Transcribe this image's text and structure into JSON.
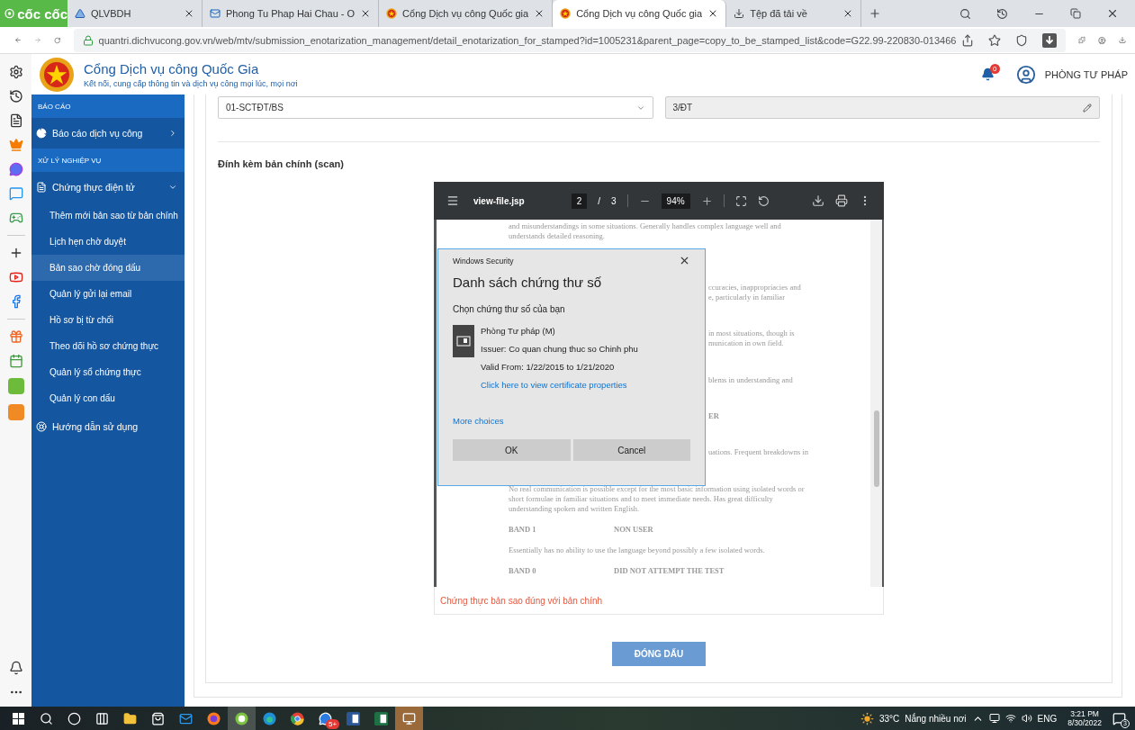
{
  "browser": {
    "logo_text": "cốc cốc",
    "tabs": [
      {
        "label": "QLVBDH",
        "kind": "portal",
        "selected": false
      },
      {
        "label": "Phong Tu Phap Hai Chau - O",
        "kind": "mail",
        "selected": false
      },
      {
        "label": "Cổng Dịch vụ công Quốc gia",
        "kind": "emblem",
        "selected": false
      },
      {
        "label": "Cổng Dịch vụ công Quốc gia",
        "kind": "emblem",
        "selected": true
      },
      {
        "label": "Tệp đã tải về",
        "kind": "download",
        "selected": false
      }
    ],
    "url": "quantri.dichvucong.gov.vn/web/mtv/submission_enotarization_management/detail_enotarization_for_stamped?id=1005231&parent_page=copy_to_be_stamped_list&code=G22.99-220830-013466"
  },
  "header": {
    "title": "Cổng Dịch vụ công Quốc Gia",
    "subtitle": "Kết nối, cung cấp thông tin và dịch vụ công mọi lúc, mọi nơi",
    "notifications": "0",
    "user": "PHÒNG TƯ PHÁP"
  },
  "sidebar": {
    "items": [
      {
        "kind": "section",
        "label": "BÁO CÁO"
      },
      {
        "kind": "menu",
        "label": "Báo cáo dịch vụ công",
        "expanded": false
      },
      {
        "kind": "section",
        "label": "XỬ LÝ NGHIỆP VỤ"
      },
      {
        "kind": "menu",
        "label": "Chứng thực điện tử",
        "expanded": true,
        "children": [
          {
            "label": "Thêm mới bản sao từ bản chính",
            "selected": false
          },
          {
            "label": "Lịch hẹn chờ duyệt",
            "selected": false
          },
          {
            "label": "Bản sao chờ đóng dấu",
            "selected": true
          },
          {
            "label": "Quản lý gửi lại email",
            "selected": false
          },
          {
            "label": "Hồ sơ bị từ chối",
            "selected": false
          },
          {
            "label": "Theo dõi hồ sơ chứng thực",
            "selected": false
          },
          {
            "label": "Quản lý sổ chứng thực",
            "selected": false
          },
          {
            "label": "Quản lý con dấu",
            "selected": false
          }
        ]
      },
      {
        "kind": "menu",
        "label": "Hướng dẫn sử dụng"
      }
    ]
  },
  "form": {
    "fields": [
      {
        "kind": "select",
        "value": "01-SCTĐT/BS"
      },
      {
        "kind": "readonly",
        "value": "3/ĐT"
      }
    ],
    "attachment_label": "Đính kèm bản chính (scan)"
  },
  "viewer": {
    "file": "view-file.jsp",
    "page": "2",
    "page_separator": "/",
    "page_count": "3",
    "zoom": "94%",
    "blocks": [
      {
        "kind": "paragraph",
        "lines": [
          "and misunderstandings in some situations. Generally handles complex language well and",
          "understands detailed reasoning."
        ]
      },
      {
        "kind": "clipped",
        "lines": [
          "ccuracies, inappropriacies and",
          "e, particularly in familiar"
        ]
      },
      {
        "kind": "clipped",
        "lines": [
          "in most situations, though is",
          "munication in own field."
        ]
      },
      {
        "kind": "clipped",
        "lines": [
          "blems in understanding and"
        ]
      },
      {
        "kind": "clipped_heading",
        "lines": [
          "ER"
        ]
      },
      {
        "kind": "clipped",
        "lines": [
          "uations. Frequent breakdowns in"
        ]
      },
      {
        "kind": "paragraph",
        "lines": [
          "No real communication is possible except for the most basic information using isolated words or",
          "short formulae in familiar situations and to meet immediate needs. Has great difficulty",
          "understanding spoken and written English."
        ]
      },
      {
        "kind": "band",
        "label": "BAND 1",
        "name": "NON USER"
      },
      {
        "kind": "paragraph",
        "lines": [
          "Essentially has no ability to use the language beyond possibly a few isolated words."
        ]
      },
      {
        "kind": "band",
        "label": "BAND 0",
        "name": "DID NOT ATTEMPT THE TEST"
      }
    ]
  },
  "dialog": {
    "caption": "Windows Security",
    "title": "Danh sách chứng thư số",
    "prompt": "Chọn chứng thư số của bạn",
    "certificate": {
      "name": "Phòng Tư pháp (M)",
      "issuer": "Issuer: Co quan chung thuc so Chinh phu",
      "validity": "Valid From: 1/22/2015 to 1/21/2020",
      "link": "Click here to view certificate properties"
    },
    "more_choices": "More choices",
    "buttons": [
      "OK",
      "Cancel"
    ]
  },
  "note": "Chứng thực bản sao đúng với bản chính",
  "stamp_button": "ĐÓNG DẤU",
  "taskbar": {
    "apps": [
      {
        "kind": "start",
        "selected": false
      },
      {
        "kind": "search",
        "selected": false
      },
      {
        "kind": "cortana",
        "selected": false
      },
      {
        "kind": "taskview",
        "selected": false
      },
      {
        "kind": "folder",
        "selected": false
      },
      {
        "kind": "store",
        "selected": false
      },
      {
        "kind": "mail",
        "selected": false
      },
      {
        "kind": "fox",
        "selected": false
      },
      {
        "kind": "coccoc",
        "selected": true
      },
      {
        "kind": "edge",
        "selected": false
      },
      {
        "kind": "chrome",
        "selected": false
      },
      {
        "kind": "chat",
        "selected": false,
        "badge": "5+"
      },
      {
        "kind": "word",
        "selected": false
      },
      {
        "kind": "sheet",
        "selected": false
      },
      {
        "kind": "app",
        "selected": true
      }
    ],
    "temperature": "33°C",
    "weather": "Nắng nhiều nơi",
    "language": "ENG",
    "time": "3:21 PM",
    "date": "8/30/2022",
    "notifications": "3"
  }
}
